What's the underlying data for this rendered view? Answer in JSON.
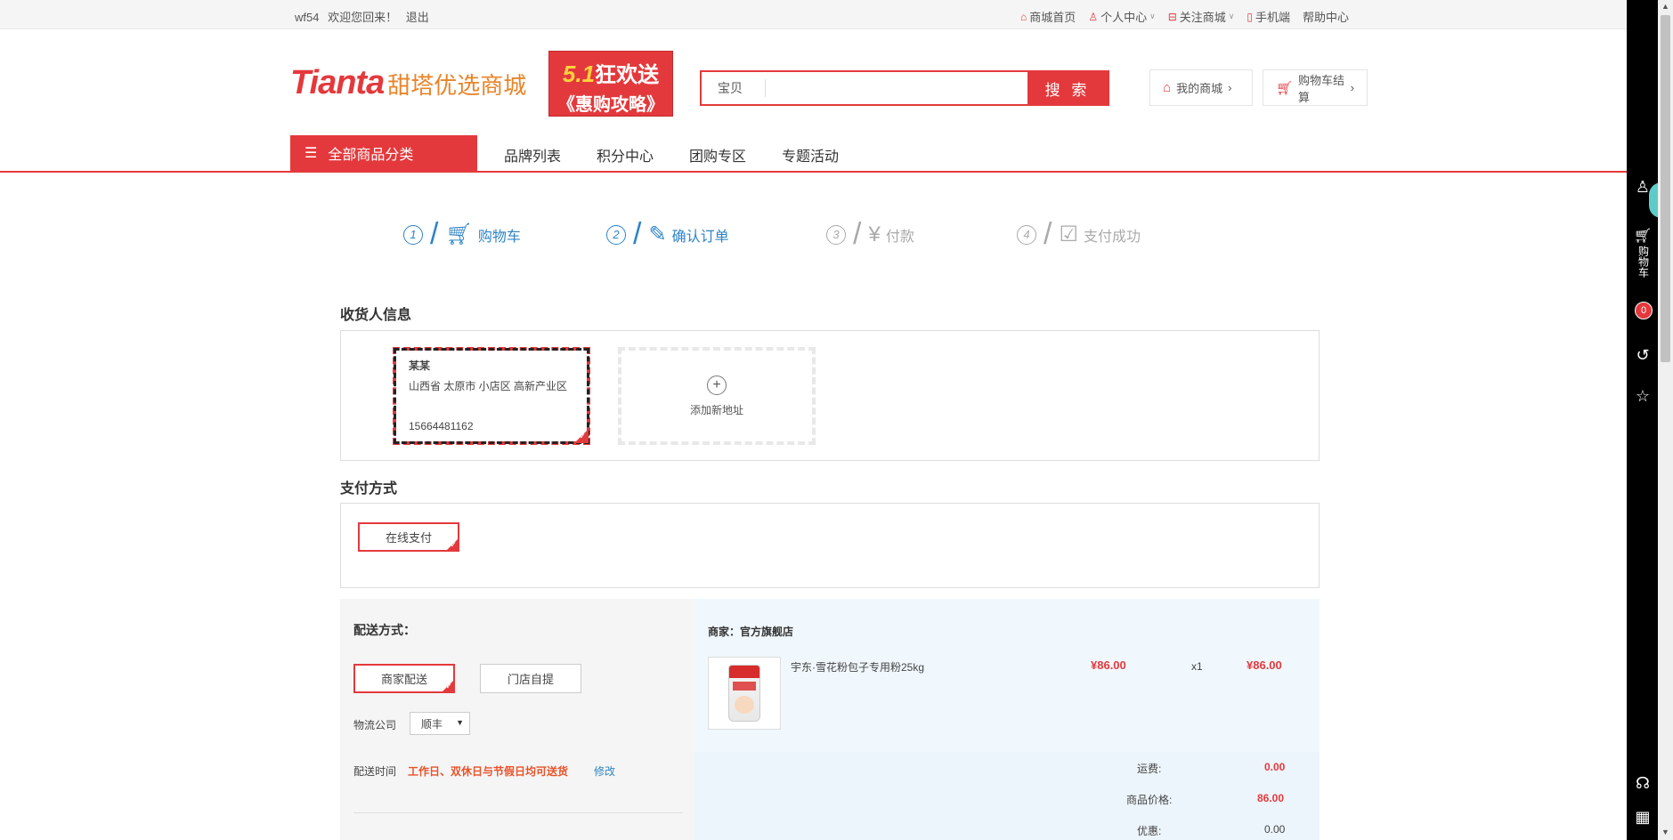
{
  "topbar": {
    "username": "wf54",
    "welcome": "欢迎您回来！",
    "logout": "退出",
    "links": [
      {
        "label": "商城首页",
        "icon": "home-icon",
        "caret": false
      },
      {
        "label": "个人中心",
        "icon": "user-icon",
        "caret": true
      },
      {
        "label": "关注商城",
        "icon": "follow-icon",
        "caret": true
      },
      {
        "label": "手机端",
        "icon": "phone-icon",
        "caret": false
      },
      {
        "label": "帮助中心",
        "icon": "",
        "caret": false
      }
    ]
  },
  "header": {
    "logo_en": "Tianta",
    "logo_cn": "甜塔优选商城",
    "promo_line1_num": "5.1",
    "promo_line1_text": "狂欢送",
    "promo_line2": "《惠购攻略》",
    "search_label": "宝贝",
    "search_placeholder": "",
    "search_button": "搜 索",
    "my_store": "我的商城",
    "cart_checkout": "购物车结算"
  },
  "nav": {
    "all_categories": "全部商品分类",
    "links": [
      "品牌列表",
      "积分中心",
      "团购专区",
      "专题活动"
    ]
  },
  "steps": [
    {
      "num": "1",
      "label": "购物车",
      "icon": "cart-icon",
      "state": "active"
    },
    {
      "num": "2",
      "label": "确认订单",
      "icon": "edit-icon",
      "state": "active"
    },
    {
      "num": "3",
      "label": "付款",
      "icon": "yen-icon",
      "state": "inactive"
    },
    {
      "num": "4",
      "label": "支付成功",
      "icon": "check-box-icon",
      "state": "inactive"
    }
  ],
  "receiver": {
    "title": "收货人信息",
    "address": {
      "name": "某某",
      "detail": "山西省 太原市 小店区 高新产业区",
      "phone": "15664481162"
    },
    "add_new": "添加新地址"
  },
  "payment": {
    "title": "支付方式",
    "option": "在线支付"
  },
  "delivery": {
    "title": "配送方式：",
    "options": [
      "商家配送",
      "门店自提"
    ],
    "logistics_label": "物流公司",
    "logistics_value": "顺丰",
    "time_label": "配送时间",
    "time_value": "工作日、双休日与节假日均可送货",
    "modify": "修改"
  },
  "order": {
    "merchant": "商家：官方旗舰店",
    "product_name": "宇东·雪花粉包子专用粉25kg",
    "unit_price": "¥86.00",
    "quantity": "x1",
    "subtotal": "¥86.00",
    "shipping_label": "运费:",
    "shipping_value": "0.00",
    "goods_label": "商品价格:",
    "goods_value": "86.00",
    "discount_label": "优惠:",
    "discount_value": "0.00"
  },
  "sidebar": {
    "cart_label": "购物车",
    "cart_count": "0"
  },
  "colors": {
    "brand_red": "#e4393c",
    "step_blue": "#2e84c6",
    "logo_orange": "#e8842a"
  }
}
